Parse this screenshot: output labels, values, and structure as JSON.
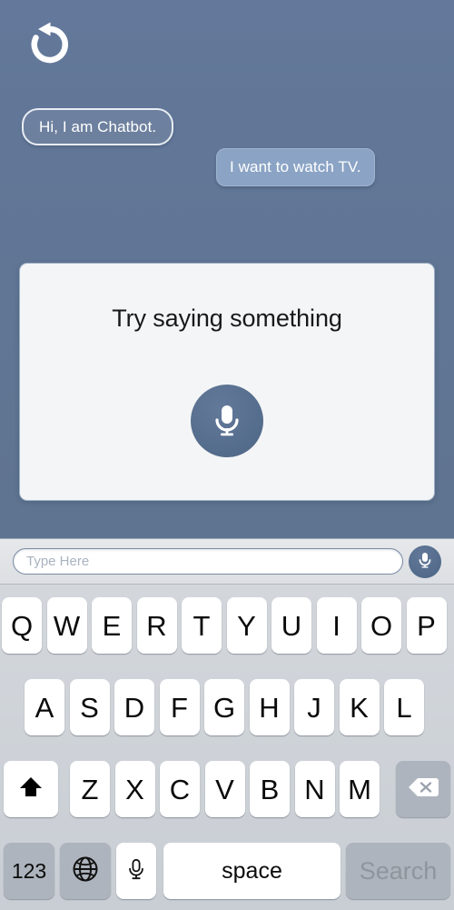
{
  "theme": {
    "background": "#5f7490",
    "bubble_user_bg": "#8ba4c5",
    "bubble_bot_border": "#e8edf4",
    "card_bg": "#f4f5f6",
    "mic_circle": "#5b7291",
    "keyboard_bg": "#d1d5da",
    "key_white": "#ffffff",
    "key_gray": "#adb4bd"
  },
  "header": {
    "reset_icon": "reset-undo-icon"
  },
  "conversation": {
    "messages": [
      {
        "sender": "bot",
        "text": "Hi, I am Chatbot."
      },
      {
        "sender": "user",
        "text": "I want to watch TV."
      }
    ]
  },
  "voice_card": {
    "title": "Try saying something",
    "mic_icon": "microphone-icon"
  },
  "input_bar": {
    "placeholder": "Type Here",
    "value": "",
    "mic_icon": "microphone-icon"
  },
  "keyboard": {
    "row1": [
      "Q",
      "W",
      "E",
      "R",
      "T",
      "Y",
      "U",
      "I",
      "O",
      "P"
    ],
    "row2": [
      "A",
      "S",
      "D",
      "F",
      "G",
      "H",
      "J",
      "K",
      "L"
    ],
    "row3": [
      "Z",
      "X",
      "C",
      "V",
      "B",
      "N",
      "M"
    ],
    "shift_icon": "shift-arrow-icon",
    "backspace_icon": "backspace-icon",
    "numbers_label": "123",
    "globe_icon": "globe-icon",
    "mic_icon": "microphone-icon",
    "space_label": "space",
    "search_label": "Search"
  }
}
